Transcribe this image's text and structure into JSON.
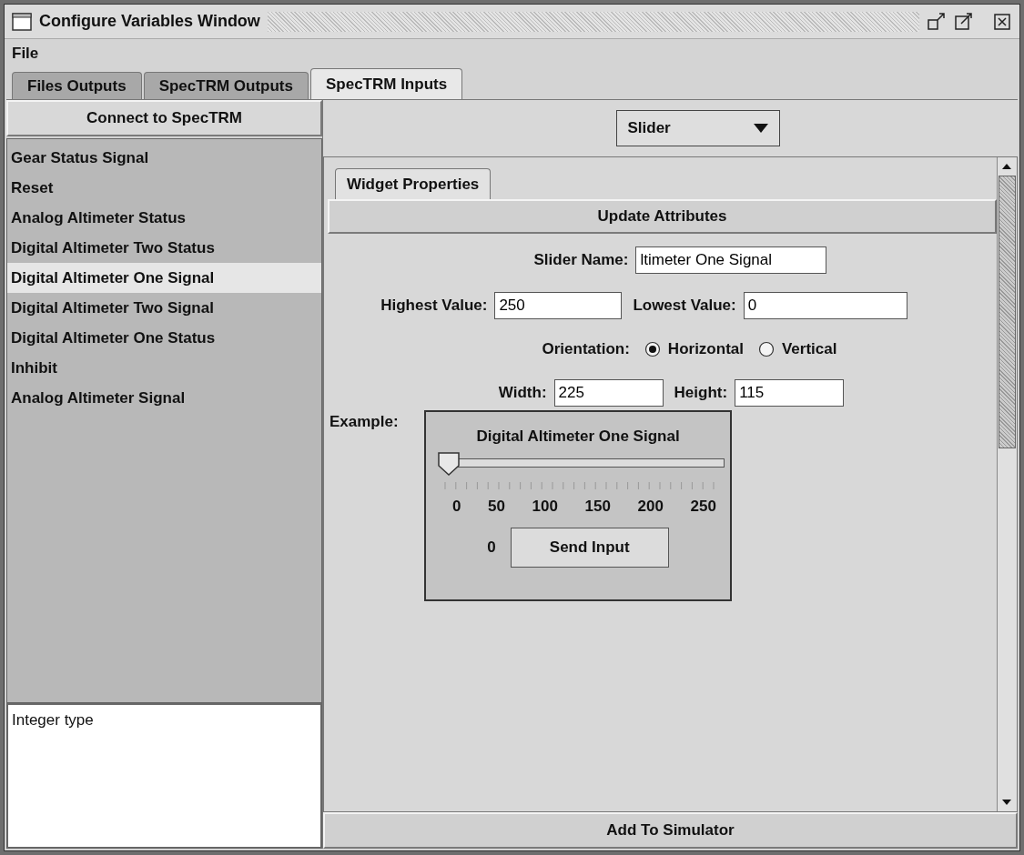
{
  "window": {
    "title": "Configure Variables Window"
  },
  "menu": [
    "File"
  ],
  "tabs": [
    {
      "label": "Files Outputs",
      "selected": false
    },
    {
      "label": "SpecTRM Outputs",
      "selected": false
    },
    {
      "label": "SpecTRM Inputs",
      "selected": true
    }
  ],
  "left": {
    "connect_button": "Connect to SpecTRM",
    "variables": [
      {
        "label": "Gear Status Signal",
        "selected": false
      },
      {
        "label": "Reset",
        "selected": false
      },
      {
        "label": "Analog Altimeter Status",
        "selected": false
      },
      {
        "label": "Digital Altimeter Two Status",
        "selected": false
      },
      {
        "label": "Digital Altimeter One Signal",
        "selected": true
      },
      {
        "label": "Digital Altimeter Two Signal",
        "selected": false
      },
      {
        "label": "Digital Altimeter One Status",
        "selected": false
      },
      {
        "label": "Inhibit",
        "selected": false
      },
      {
        "label": "Analog Altimeter Signal",
        "selected": false
      }
    ],
    "description": "Integer type"
  },
  "widget_type": "Slider",
  "inner_tabs": [
    {
      "label": "Widget Properties",
      "selected": true
    }
  ],
  "update_button": "Update Attributes",
  "fields": {
    "slider_name": {
      "label": "Slider Name:",
      "value": "ltimeter One Signal"
    },
    "highest": {
      "label": "Highest Value:",
      "value": "250"
    },
    "lowest": {
      "label": "Lowest Value:",
      "value": "0"
    },
    "width": {
      "label": "Width:",
      "value": "225"
    },
    "height": {
      "label": "Height:",
      "value": "115"
    }
  },
  "orientation": {
    "label": "Orientation:",
    "options": [
      {
        "label": "Horizontal",
        "selected": true
      },
      {
        "label": "Vertical",
        "selected": false
      }
    ]
  },
  "example": {
    "label": "Example:",
    "title": "Digital Altimeter One Signal",
    "level": 0,
    "tick_labels": [
      "0",
      "50",
      "100",
      "150",
      "200",
      "250"
    ],
    "reading": "0",
    "send_button": "Send Input"
  },
  "add_button": "Add To Simulator"
}
